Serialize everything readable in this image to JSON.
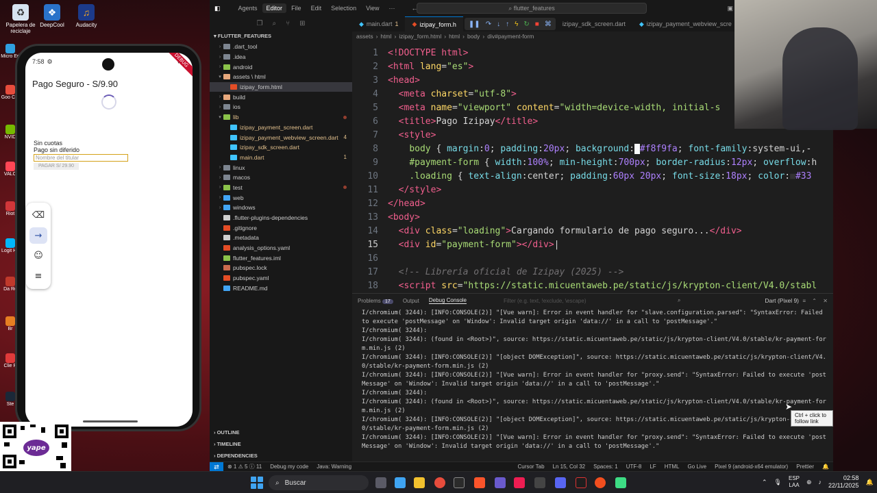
{
  "desktop": {
    "icons": [
      {
        "label": "Papelera de reciclaje"
      },
      {
        "label": "DeepCool"
      },
      {
        "label": "Audacity"
      }
    ],
    "left_strip": [
      "Micro Ed",
      "Goo Chr",
      "NVID",
      "VALO",
      "Riot",
      "Logit Hu",
      "Da Re",
      "Br",
      "Clie R",
      "Ste"
    ]
  },
  "phone": {
    "time": "7:58",
    "debug_ribbon": "DEBUG",
    "title": "Pago Seguro - S/9.90",
    "line1": "Sin cuotas",
    "line2": "Pago sin diferido",
    "holder_placeholder": "Nombre del titular",
    "pay_button": "PAGAR S/ 29.90"
  },
  "emulator_toolbar": {
    "buttons": [
      {
        "icon": "backspace-icon",
        "glyph": "⌫"
      },
      {
        "icon": "arrow-right-icon",
        "glyph": "→"
      },
      {
        "icon": "emoji-icon",
        "glyph": "☺"
      },
      {
        "icon": "menu-icon",
        "glyph": "≡"
      }
    ]
  },
  "qr": {
    "label": "yape"
  },
  "ide": {
    "titlebar": {
      "agents": "Agents",
      "editor": "Editor",
      "menu": [
        "File",
        "Edit",
        "Selection",
        "View",
        "···"
      ],
      "search": "flutter_features"
    },
    "explorer": {
      "root": "FLUTTER_FEATURES",
      "items": [
        {
          "label": ".dart_tool",
          "depth": 1,
          "type": "folder",
          "color": "#7d8590",
          "collapsed": true
        },
        {
          "label": ".idea",
          "depth": 1,
          "type": "folder",
          "color": "#7d8590",
          "collapsed": true
        },
        {
          "label": "android",
          "depth": 1,
          "type": "folder",
          "color": "#8bc34a",
          "collapsed": true
        },
        {
          "label": "assets \\ html",
          "depth": 1,
          "type": "folder",
          "color": "#e8a87c",
          "collapsed": false
        },
        {
          "label": "izipay_form.html",
          "depth": 2,
          "type": "file",
          "color": "#e44d26",
          "selected": true
        },
        {
          "label": "build",
          "depth": 1,
          "type": "folder",
          "color": "#e8a87c",
          "collapsed": true
        },
        {
          "label": "ios",
          "depth": 1,
          "type": "folder",
          "color": "#7d8590",
          "collapsed": true
        },
        {
          "label": "lib",
          "depth": 1,
          "type": "folder",
          "color": "#8bc34a",
          "collapsed": false,
          "dot": true,
          "label_color": "#e2c08d"
        },
        {
          "label": "izipay_payment_screen.dart",
          "depth": 2,
          "type": "file",
          "color": "#40c4ff",
          "label_color": "#e2c08d"
        },
        {
          "label": "izipay_payment_webview_screen.dart",
          "depth": 2,
          "type": "file",
          "color": "#40c4ff",
          "badge": "4",
          "label_color": "#e2c08d"
        },
        {
          "label": "izipay_sdk_screen.dart",
          "depth": 2,
          "type": "file",
          "color": "#40c4ff",
          "label_color": "#e2c08d"
        },
        {
          "label": "main.dart",
          "depth": 2,
          "type": "file",
          "color": "#40c4ff",
          "badge": "1",
          "label_color": "#e2c08d"
        },
        {
          "label": "linux",
          "depth": 1,
          "type": "folder",
          "color": "#7d8590",
          "collapsed": true
        },
        {
          "label": "macos",
          "depth": 1,
          "type": "folder",
          "color": "#7d8590",
          "collapsed": true
        },
        {
          "label": "test",
          "depth": 1,
          "type": "folder",
          "color": "#8bc34a",
          "collapsed": true,
          "dot": true
        },
        {
          "label": "web",
          "depth": 1,
          "type": "folder",
          "color": "#42a5f5",
          "collapsed": true
        },
        {
          "label": "windows",
          "depth": 1,
          "type": "folder",
          "color": "#42a5f5",
          "collapsed": true
        },
        {
          "label": ".flutter-plugins-dependencies",
          "depth": 1,
          "type": "file",
          "color": "#cfcfcf"
        },
        {
          "label": ".gitignore",
          "depth": 1,
          "type": "file",
          "color": "#e44d26"
        },
        {
          "label": ".metadata",
          "depth": 1,
          "type": "file",
          "color": "#cfcfcf"
        },
        {
          "label": "analysis_options.yaml",
          "depth": 1,
          "type": "file",
          "color": "#e44d26"
        },
        {
          "label": "flutter_features.iml",
          "depth": 1,
          "type": "file",
          "color": "#8bc34a"
        },
        {
          "label": "pubspec.lock",
          "depth": 1,
          "type": "file",
          "color": "#cb6b4e"
        },
        {
          "label": "pubspec.yaml",
          "depth": 1,
          "type": "file",
          "color": "#e44d26"
        },
        {
          "label": "README.md",
          "depth": 1,
          "type": "file",
          "color": "#42a5f5"
        }
      ],
      "bottom_sections": [
        "OUTLINE",
        "TIMELINE",
        "DEPENDENCIES"
      ]
    },
    "tabs": [
      {
        "label": "main.dart",
        "badge": "1",
        "active": false
      },
      {
        "label": "izipay_form.h",
        "active": true
      },
      {
        "label": "izipay_sdk_screen.dart",
        "active": false
      },
      {
        "label": "izipay_payment_webview_scre",
        "active": false
      }
    ],
    "breadcrumb": [
      "assets",
      "html",
      "izipay_form.html",
      "html",
      "body",
      "div#payment-form"
    ],
    "code": [
      {
        "n": "1",
        "html": "<span class='tag'>&lt;!DOCTYPE html&gt;</span>"
      },
      {
        "n": "2",
        "html": "<span class='tag'>&lt;html</span> <span class='attr'>lang</span>=<span class='str'>\"es\"</span><span class='tag'>&gt;</span>"
      },
      {
        "n": "3",
        "html": "<span class='tag'>&lt;head&gt;</span>"
      },
      {
        "n": "4",
        "html": "  <span class='tag'>&lt;meta</span> <span class='attr'>charset</span>=<span class='str'>\"utf-8\"</span><span class='tag'>&gt;</span>"
      },
      {
        "n": "5",
        "html": "  <span class='tag'>&lt;meta</span> <span class='attr'>name</span>=<span class='str'>\"viewport\"</span> <span class='attr'>content</span>=<span class='str'>\"width=device-width, initial-s</span>"
      },
      {
        "n": "6",
        "html": "  <span class='tag'>&lt;title&gt;</span>Pago Izipay<span class='tag'>&lt;/title&gt;</span>"
      },
      {
        "n": "7",
        "html": "  <span class='tag'>&lt;style&gt;</span>"
      },
      {
        "n": "8",
        "html": "    <span class='sel'>body</span> { <span class='prop'>margin</span>:<span class='num'>0</span>; <span class='prop'>padding</span>:<span class='num'>20px</span>; <span class='prop'>background</span>:<span style='background:#f8f9fa;color:#f8f9fa'>■</span><span class='num'>#f8f9fa</span>; <span class='prop'>font-family</span>:system-ui,-"
      },
      {
        "n": "9",
        "html": "    <span class='sel'>#payment-form</span> { <span class='prop'>width</span>:<span class='num'>100%</span>; <span class='prop'>min-height</span>:<span class='num'>700px</span>; <span class='prop'>border-radius</span>:<span class='num'>12px</span>; <span class='prop'>overflow</span>:h"
      },
      {
        "n": "10",
        "html": "    <span class='sel'>.loading</span> { <span class='prop'>text-align</span>:center; <span class='prop'>padding</span>:<span class='num'>60px 20px</span>; <span class='prop'>font-size</span>:<span class='num'>18px</span>; <span class='prop'>color</span>:<span style='color:#333'>■</span><span class='num'>#33</span>"
      },
      {
        "n": "11",
        "html": "  <span class='tag'>&lt;/style&gt;</span>"
      },
      {
        "n": "12",
        "html": "<span class='tag'>&lt;/head&gt;</span>"
      },
      {
        "n": "13",
        "html": "<span class='tag'>&lt;body&gt;</span>"
      },
      {
        "n": "14",
        "html": "  <span class='tag'>&lt;div</span> <span class='attr'>class</span>=<span class='str'>\"loading\"</span><span class='tag'>&gt;</span>Cargando formulario de pago seguro...<span class='tag'>&lt;/div&gt;</span>"
      },
      {
        "n": "15",
        "html": "  <span class='tag'>&lt;div</span> <span class='attr'>id</span>=<span class='str'>\"payment-form\"</span><span class='tag'>&gt;&lt;/div&gt;</span>|",
        "current": true
      },
      {
        "n": "16",
        "html": ""
      },
      {
        "n": "17",
        "html": "  <span class='cmt'>&lt;!-- Librería oficial de Izipay (2025) --&gt;</span>"
      },
      {
        "n": "18",
        "html": "  <span class='tag'>&lt;script</span> <span class='attr'>src</span>=<span class='str'>\"https://static.micuentaweb.pe/static/js/krypton-client/V4.0/stabl</span>"
      }
    ],
    "panel": {
      "tabs": [
        {
          "label": "Problems",
          "badge": "17"
        },
        {
          "label": "Output"
        },
        {
          "label": "Debug Console",
          "active": true
        }
      ],
      "filter_placeholder": "Filter (e.g. text, !exclude, \\escape)",
      "device": "Dart (Pixel 9)",
      "logs": [
        "I/chromium( 3244): [INFO:CONSOLE(2)] \"[Vue warn]: Error in event handler for \"slave.configuration.parsed\": \"SyntaxError: Failed to execute 'postMessage' on 'Window': Invalid target origin 'data://' in a call to 'postMessage'.\"",
        "I/chromium( 3244):",
        "I/chromium( 3244): (found in <Root>)\", source: https://static.micuentaweb.pe/static/js/krypton-client/V4.0/stable/kr-payment-form.min.js (2)",
        "I/chromium( 3244): [INFO:CONSOLE(2)] \"[object DOMException]\", source: https://static.micuentaweb.pe/static/js/krypton-client/V4.0/stable/kr-payment-form.min.js (2)",
        "I/chromium( 3244): [INFO:CONSOLE(2)] \"[Vue warn]: Error in event handler for \"proxy.send\": \"SyntaxError: Failed to execute 'postMessage' on 'Window': Invalid target origin 'data://' in a call to 'postMessage'.\"",
        "I/chromium( 3244):",
        "I/chromium( 3244): (found in <Root>)\", source: https://static.micuentaweb.pe/static/js/krypton-client/V4.0/stable/kr-payment-form.min.js (2)",
        "I/chromium( 3244): [INFO:CONSOLE(2)] \"[object DOMException]\", source: https://static.micuentaweb.pe/static/js/krypton-client/V4.0/stable/kr-payment-form.min.js (2)",
        "I/chromium( 3244): [INFO:CONSOLE(2)] \"[Vue warn]: Error in event handler for \"proxy.send\": \"SyntaxError: Failed to execute 'postMessage' on 'Window': Invalid target origin 'data://' in a call to 'postMessage'.\""
      ],
      "tooltip": "Ctrl + click to follow link"
    },
    "statusbar": {
      "problems": "⊗ 1 ⚠ 5 ⓘ 11",
      "debug": "Debug my code",
      "java": "Java: Warning",
      "cursor_tab": "Cursor Tab",
      "position": "Ln 15, Col 32",
      "spaces": "Spaces: 1",
      "encoding": "UTF-8",
      "eol": "LF",
      "language": "HTML",
      "golive": "Go Live",
      "device": "Pixel 9 (android-x64 emulator)",
      "prettier": "Prettier"
    }
  },
  "taskbar": {
    "search": "Buscar",
    "lang_top": "ESP",
    "lang_bottom": "LAA",
    "time": "02:58",
    "date": "22/11/2025"
  },
  "colors": {
    "accent": "#0078d4",
    "tag": "#f25f8e",
    "string": "#a9dc76"
  }
}
